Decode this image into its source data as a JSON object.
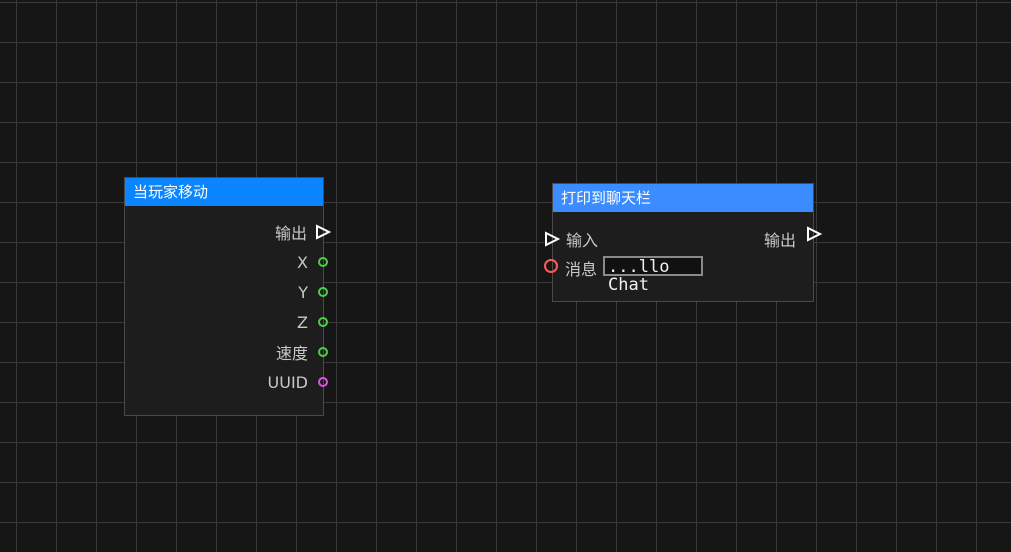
{
  "nodes": {
    "event_node": {
      "title": "当玩家移动",
      "header_color": "#0a84ff",
      "outputs": {
        "exec": "输出",
        "x": "X",
        "y": "Y",
        "z": "Z",
        "speed": "速度",
        "uuid": "UUID"
      },
      "pin_colors": {
        "exec": "#ffffff",
        "number": "#47d147",
        "uuid": "#e14fe1"
      }
    },
    "print_node": {
      "title": "打印到聊天栏",
      "header_color": "#3b8cff",
      "inputs": {
        "exec": "输入",
        "message": "消息",
        "message_value": "...llo Chat"
      },
      "outputs": {
        "exec": "输出"
      },
      "pin_colors": {
        "exec": "#ffffff",
        "string": "#ff5a5a"
      }
    }
  },
  "icons": {
    "exec_pin": "triangle-outline-icon",
    "data_pin": "circle-outline-icon"
  }
}
